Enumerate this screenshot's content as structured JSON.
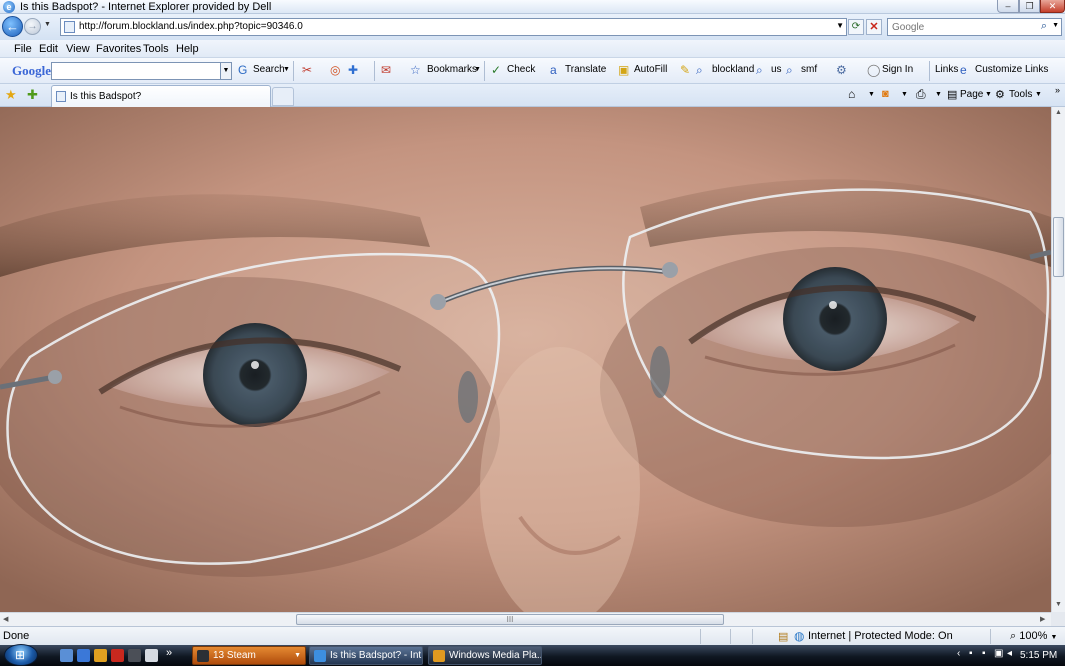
{
  "window": {
    "title": "Is this Badspot? - Internet Explorer provided by Dell",
    "controls": {
      "minimize": "–",
      "maximize": "❐",
      "close": "✕"
    }
  },
  "address": {
    "url": "http://forum.blockland.us/index.php?topic=90346.0",
    "search_placeholder": "Google"
  },
  "menu": [
    "File",
    "Edit",
    "View",
    "Favorites",
    "Tools",
    "Help"
  ],
  "google_toolbar": {
    "logo": "Google",
    "search": "Search",
    "bookmarks": "Bookmarks",
    "check": "Check",
    "translate": "Translate",
    "autofill": "AutoFill",
    "bookmark_blockland": "blockland",
    "bookmark_us": "us",
    "bookmark_smf": "smf",
    "sign_in": "Sign In",
    "links": "Links",
    "customize_links": "Customize Links"
  },
  "tabs": [
    {
      "label": "Is this Badspot?"
    }
  ],
  "command_bar": {
    "page": "Page",
    "tools": "Tools"
  },
  "status": {
    "text": "Done",
    "zone": "Internet | Protected Mode: On",
    "zoom": "100%"
  },
  "taskbar": {
    "items": [
      {
        "label": "13 Steam"
      },
      {
        "label": "Is this Badspot? - Int..."
      },
      {
        "label": "Windows Media Pla..."
      }
    ],
    "clock": "5:15 PM"
  },
  "colors": {
    "skin": "#caa28e",
    "iris": "#3a4a55",
    "chrome": "#dce7f5",
    "taskbar": "#0f1722"
  },
  "icons": [
    "ie-icon",
    "back-arrow-icon",
    "forward-arrow-icon",
    "refresh-icon",
    "stop-icon",
    "search-icon",
    "star-icon",
    "home-icon",
    "feed-icon",
    "print-icon",
    "globe-icon",
    "zoom-icon",
    "windows-logo-icon"
  ]
}
